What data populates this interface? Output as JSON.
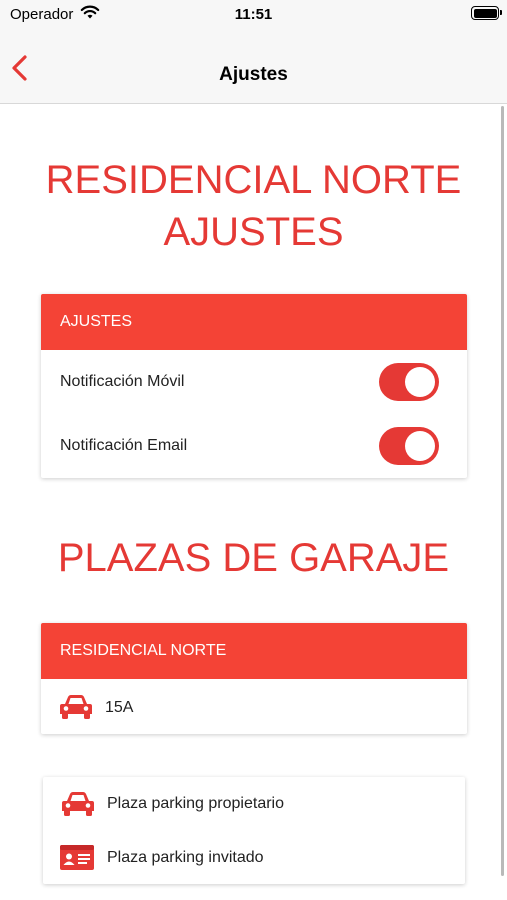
{
  "status_bar": {
    "carrier": "Operador",
    "time": "11:51"
  },
  "nav": {
    "title": "Ajustes"
  },
  "settings_section": {
    "heading_line1": "RESIDENCIAL NORTE",
    "heading_line2": "AJUSTES",
    "card_header": "AJUSTES",
    "options": [
      {
        "label": "Notificación Móvil",
        "enabled": true
      },
      {
        "label": "Notificación Email",
        "enabled": true
      }
    ]
  },
  "garage_section": {
    "heading": "PLAZAS DE GARAJE",
    "card_header": "RESIDENCIAL NORTE",
    "spots": [
      {
        "icon": "car-icon",
        "label": "15A"
      }
    ]
  },
  "parking_links": [
    {
      "icon": "car-icon",
      "label": "Plaza parking propietario"
    },
    {
      "icon": "id-card-icon",
      "label": "Plaza parking invitado"
    }
  ],
  "colors": {
    "accent": "#e53935",
    "header_bg": "#f44336",
    "nav_bg": "#f7f7f7"
  }
}
